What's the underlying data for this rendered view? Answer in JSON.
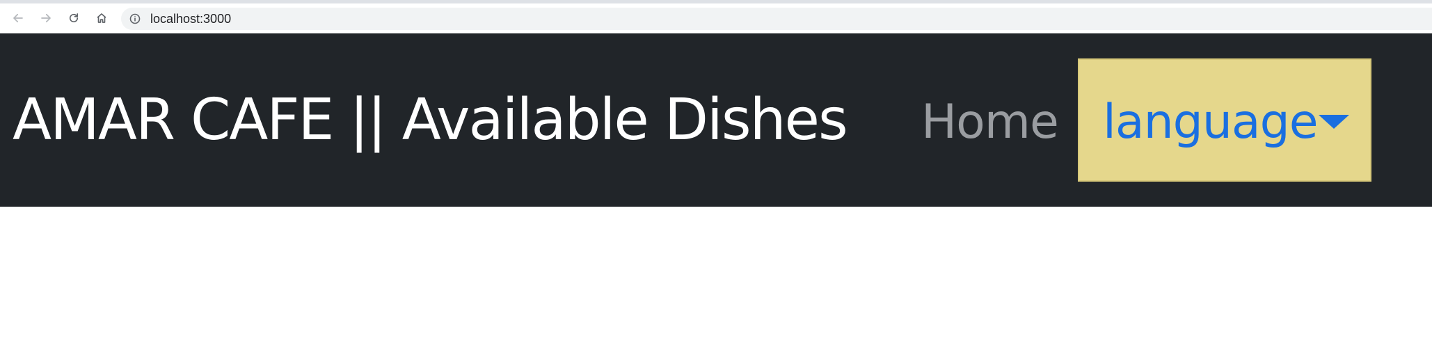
{
  "browser": {
    "url": "localhost:3000",
    "icons": {
      "back": "arrow-left-icon",
      "forward": "arrow-right-icon",
      "reload": "reload-icon",
      "home": "home-icon",
      "info": "info-icon"
    }
  },
  "navbar": {
    "brand": "AMAR CAFE || Available Dishes",
    "home_link": "Home",
    "language_dropdown": {
      "label": "language",
      "caret_icon": "caret-down-icon"
    }
  },
  "colors": {
    "navbar_bg": "#212529",
    "brand_text": "#ffffff",
    "home_text": "#9a9da1",
    "dropdown_bg": "#e5d78c",
    "dropdown_text": "#1a6fe0"
  }
}
